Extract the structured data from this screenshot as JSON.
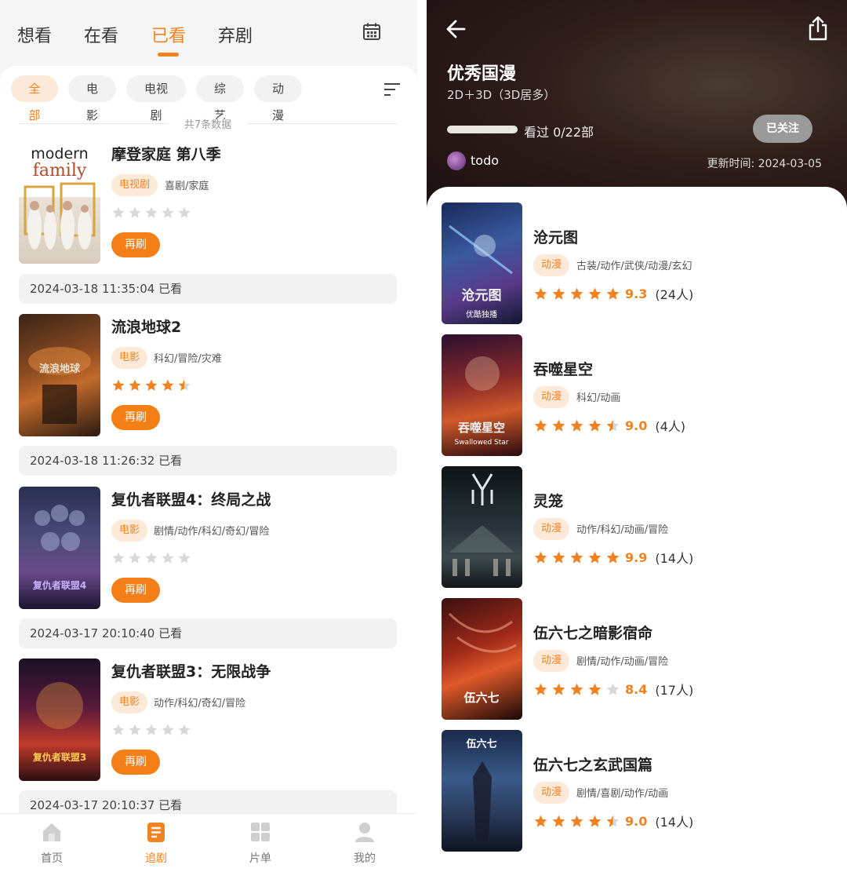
{
  "left": {
    "tabs": [
      "想看",
      "在看",
      "已看",
      "弃剧"
    ],
    "active_tab": 2,
    "filters": [
      "全部",
      "电影",
      "电视剧",
      "综艺",
      "动漫"
    ],
    "active_filter": 0,
    "count_text": "共7条数据",
    "rewatch_label": "再刷",
    "items": [
      {
        "title": "摩登家庭 第八季",
        "tag": "电视剧",
        "genres": "喜剧/家庭",
        "rating": 0,
        "poster_text": "modern family",
        "date": "2024-03-18 11:35:04 已看"
      },
      {
        "title": "流浪地球2",
        "tag": "电影",
        "genres": "科幻/冒险/灾难",
        "rating": 4.5,
        "poster_text": "",
        "date": "2024-03-18 11:26:32 已看"
      },
      {
        "title": "复仇者联盟4：终局之战",
        "tag": "电影",
        "genres": "剧情/动作/科幻/奇幻/冒险",
        "rating": 0,
        "poster_text": "",
        "date": "2024-03-17 20:10:40 已看"
      },
      {
        "title": "复仇者联盟3：无限战争",
        "tag": "电影",
        "genres": "动作/科幻/奇幻/冒险",
        "rating": 0,
        "poster_text": "",
        "date": "2024-03-17 20:10:37 已看"
      }
    ],
    "nav": [
      {
        "label": "首页",
        "icon": "home-icon"
      },
      {
        "label": "追剧",
        "icon": "list-icon"
      },
      {
        "label": "片单",
        "icon": "grid-icon"
      },
      {
        "label": "我的",
        "icon": "user-icon"
      }
    ],
    "active_nav": 1
  },
  "right": {
    "title": "优秀国漫",
    "subtitle": "2D＋3D（3D居多）",
    "progress_text": "看过 0/22部",
    "progress_fraction": 0,
    "follow_label": "已关注",
    "user_name": "todo",
    "update_time": "更新时间: 2024-03-05",
    "items": [
      {
        "title": "沧元图",
        "tag": "动漫",
        "genres": "古装/动作/武侠/动漫/玄幻",
        "stars": 5,
        "score": "9.3",
        "count": "(24人)",
        "poster_text": "沧元图",
        "poster_sub": "优酷独播"
      },
      {
        "title": "吞噬星空",
        "tag": "动漫",
        "genres": "科幻/动画",
        "stars": 4.5,
        "score": "9.0",
        "count": "(4人)",
        "poster_text": "吞噬星空",
        "poster_sub": "Swallowed Star"
      },
      {
        "title": "灵笼",
        "tag": "动漫",
        "genres": "动作/科幻/动画/冒险",
        "stars": 5,
        "score": "9.9",
        "count": "(14人)",
        "poster_text": "",
        "poster_sub": ""
      },
      {
        "title": "伍六七之暗影宿命",
        "tag": "动漫",
        "genres": "剧情/动作/动画/冒险",
        "stars": 4,
        "score": "8.4",
        "count": "(17人)",
        "poster_text": "伍六七",
        "poster_sub": ""
      },
      {
        "title": "伍六七之玄武国篇",
        "tag": "动漫",
        "genres": "剧情/喜剧/动作/动画",
        "stars": 4.5,
        "score": "9.0",
        "count": "(14人)",
        "poster_text": "伍六七",
        "poster_sub": ""
      }
    ]
  },
  "colors": {
    "accent": "#f08321",
    "tag_bg": "#fde9d7",
    "star_empty": "#d8d8d8"
  }
}
